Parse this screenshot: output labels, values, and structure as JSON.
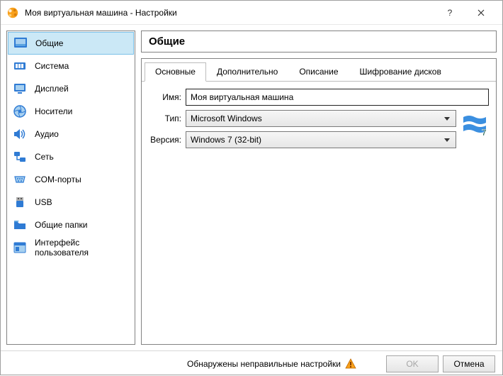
{
  "title": "Моя виртуальная машина - Настройки",
  "sidebar": {
    "items": [
      {
        "label": "Общие"
      },
      {
        "label": "Система"
      },
      {
        "label": "Дисплей"
      },
      {
        "label": "Носители"
      },
      {
        "label": "Аудио"
      },
      {
        "label": "Сеть"
      },
      {
        "label": "COM-порты"
      },
      {
        "label": "USB"
      },
      {
        "label": "Общие папки"
      },
      {
        "label": "Интерфейс пользователя"
      }
    ]
  },
  "heading": "Общие",
  "tabs": {
    "basic": "Основные",
    "advanced": "Дополнительно",
    "description": "Описание",
    "encryption": "Шифрование дисков"
  },
  "form": {
    "name_label": "Имя:",
    "name_value": "Моя виртуальная машина",
    "type_label": "Тип:",
    "type_value": "Microsoft Windows",
    "version_label": "Версия:",
    "version_value": "Windows 7 (32-bit)"
  },
  "footer": {
    "warning": "Обнаружены неправильные настройки",
    "ok": "OK",
    "cancel": "Отмена"
  }
}
